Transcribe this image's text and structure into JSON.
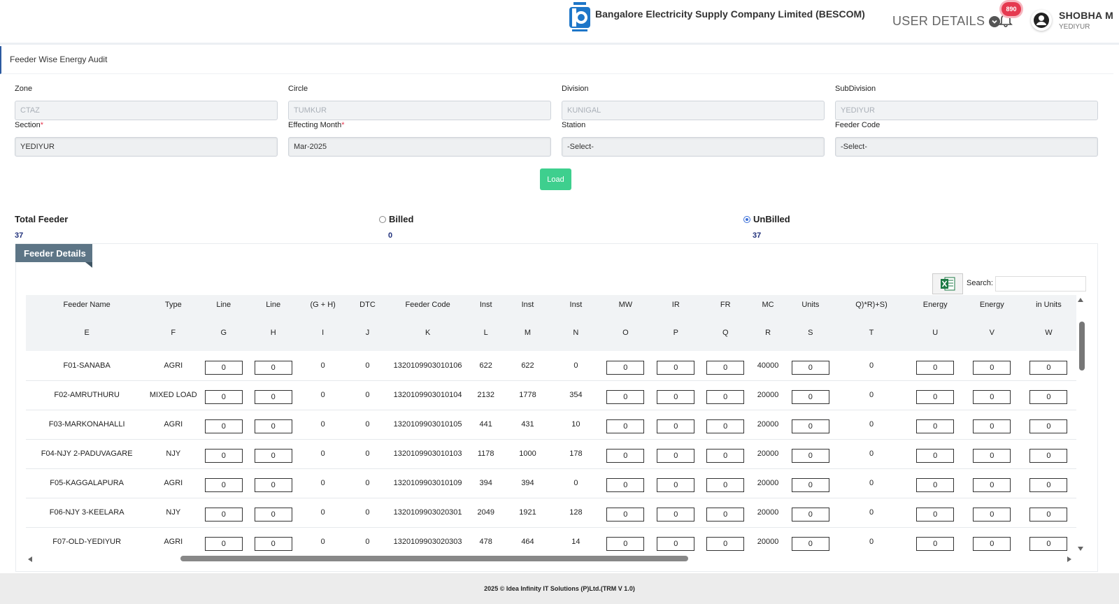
{
  "header": {
    "company": "Bangalore Electricity Supply Company Limited (BESCOM)",
    "user_details": "USER DETAILS",
    "notification_count": "890",
    "user_name": "SHOBHA M",
    "user_location": "YEDIYUR"
  },
  "page_title": "Feeder Wise Energy Audit",
  "form": {
    "zone": {
      "label": "Zone",
      "value": "CTAZ"
    },
    "circle": {
      "label": "Circle",
      "value": "TUMKUR"
    },
    "division": {
      "label": "Division",
      "value": "KUNIGAL"
    },
    "subdivision": {
      "label": "SubDivision",
      "value": "YEDIYUR"
    },
    "section": {
      "label": "Section",
      "value": "YEDIYUR"
    },
    "month": {
      "label": "Effecting Month",
      "value": "Mar-2025"
    },
    "station": {
      "label": "Station",
      "value": "-Select-"
    },
    "feeder_code": {
      "label": "Feeder Code",
      "value": "-Select-"
    },
    "required_mark": "*",
    "load_label": "Load"
  },
  "stats": {
    "total_label": "Total Feeder",
    "total_value": "37",
    "billed_label": "Billed",
    "billed_value": "0",
    "unbilled_label": "UnBilled",
    "unbilled_value": "37"
  },
  "panel": {
    "title": "Feeder Details",
    "search_label": "Search:"
  },
  "table": {
    "headers_top": [
      "Feeder Name",
      "Type",
      "Line",
      "Line",
      "(G + H)",
      "DTC",
      "Feeder Code",
      "Inst",
      "Inst",
      "Inst",
      "MW",
      "IR",
      "FR",
      "MC",
      "Units",
      "Q)*R)+S)",
      "Energy",
      "Energy",
      "in Units"
    ],
    "headers_letters": [
      "E",
      "F",
      "G",
      "H",
      "I",
      "J",
      "K",
      "L",
      "M",
      "N",
      "O",
      "P",
      "Q",
      "R",
      "S",
      "T",
      "U",
      "V",
      "W"
    ],
    "rows": [
      {
        "name": "F01-SANABA",
        "type": "AGRI",
        "g": "0",
        "h": "0",
        "i": "0",
        "j": "0",
        "code": "1320109903010106",
        "l": "622",
        "m": "622",
        "n": "0",
        "o": "0",
        "p": "0",
        "q": "0",
        "r": "40000",
        "s": "0",
        "t": "0",
        "u": "0",
        "v": "0",
        "w": "0"
      },
      {
        "name": "F02-AMRUTHURU",
        "type": "MIXED LOAD",
        "g": "0",
        "h": "0",
        "i": "0",
        "j": "0",
        "code": "1320109903010104",
        "l": "2132",
        "m": "1778",
        "n": "354",
        "o": "0",
        "p": "0",
        "q": "0",
        "r": "20000",
        "s": "0",
        "t": "0",
        "u": "0",
        "v": "0",
        "w": "0"
      },
      {
        "name": "F03-MARKONAHALLI",
        "type": "AGRI",
        "g": "0",
        "h": "0",
        "i": "0",
        "j": "0",
        "code": "1320109903010105",
        "l": "441",
        "m": "431",
        "n": "10",
        "o": "0",
        "p": "0",
        "q": "0",
        "r": "20000",
        "s": "0",
        "t": "0",
        "u": "0",
        "v": "0",
        "w": "0"
      },
      {
        "name": "F04-NJY 2-PADUVAGARE",
        "type": "NJY",
        "g": "0",
        "h": "0",
        "i": "0",
        "j": "0",
        "code": "1320109903010103",
        "l": "1178",
        "m": "1000",
        "n": "178",
        "o": "0",
        "p": "0",
        "q": "0",
        "r": "20000",
        "s": "0",
        "t": "0",
        "u": "0",
        "v": "0",
        "w": "0"
      },
      {
        "name": "F05-KAGGALAPURA",
        "type": "AGRI",
        "g": "0",
        "h": "0",
        "i": "0",
        "j": "0",
        "code": "1320109903010109",
        "l": "394",
        "m": "394",
        "n": "0",
        "o": "0",
        "p": "0",
        "q": "0",
        "r": "20000",
        "s": "0",
        "t": "0",
        "u": "0",
        "v": "0",
        "w": "0"
      },
      {
        "name": "F06-NJY 3-KEELARA",
        "type": "NJY",
        "g": "0",
        "h": "0",
        "i": "0",
        "j": "0",
        "code": "1320109903020301",
        "l": "2049",
        "m": "1921",
        "n": "128",
        "o": "0",
        "p": "0",
        "q": "0",
        "r": "20000",
        "s": "0",
        "t": "0",
        "u": "0",
        "v": "0",
        "w": "0"
      },
      {
        "name": "F07-OLD-YEDIYUR",
        "type": "AGRI",
        "g": "0",
        "h": "0",
        "i": "0",
        "j": "0",
        "code": "1320109903020303",
        "l": "478",
        "m": "464",
        "n": "14",
        "o": "0",
        "p": "0",
        "q": "0",
        "r": "20000",
        "s": "0",
        "t": "0",
        "u": "0",
        "v": "0",
        "w": "0"
      }
    ]
  },
  "footer": "2025 © Idea Infinity IT Solutions (P)Ltd.(TRM V 1.0)"
}
